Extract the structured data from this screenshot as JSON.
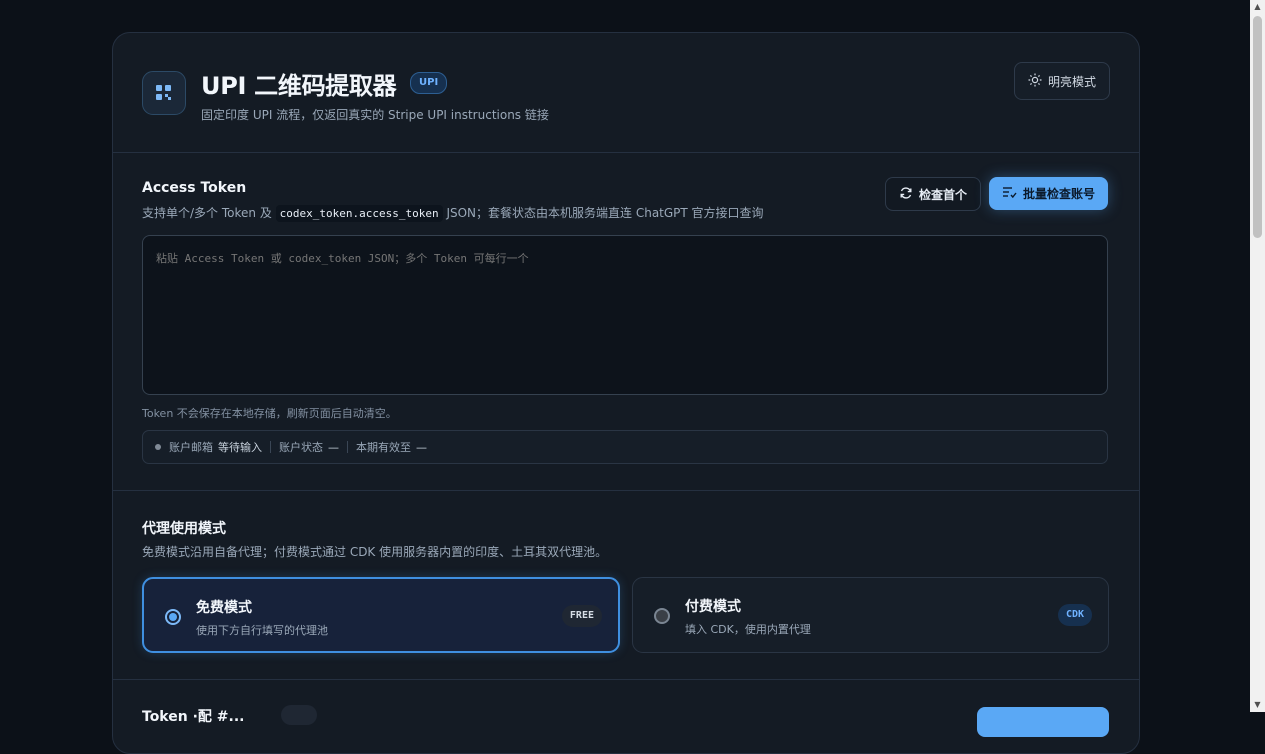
{
  "header": {
    "title": "UPI 二维码提取器",
    "badge": "UPI",
    "subtitle": "固定印度 UPI 流程，仅返回真实的 Stripe UPI instructions 链接",
    "theme_button": "明亮模式"
  },
  "token_section": {
    "title": "Access Token",
    "desc_prefix": "支持单个/多个 Token 及",
    "desc_code": "codex_token.access_token",
    "desc_suffix": "JSON；套餐状态由本机服务端直连 ChatGPT 官方接口查询",
    "check_first_button": "检查首个",
    "batch_check_button": "批量检查账号",
    "textarea_placeholder": "粘贴 Access Token 或 codex_token JSON；多个 Token 可每行一个",
    "note": "Token 不会保存在本地存储，刷新页面后自动清空。",
    "status": {
      "email_label": "账户邮箱",
      "email_value": "等待输入",
      "account_label": "账户状态",
      "account_value": "—",
      "expiry_label": "本期有效至",
      "expiry_value": "—"
    }
  },
  "proxy_section": {
    "title": "代理使用模式",
    "desc": "免费模式沿用自备代理；付费模式通过 CDK 使用服务器内置的印度、土耳其双代理池。",
    "modes": [
      {
        "title": "免费模式",
        "desc": "使用下方自行填写的代理池",
        "tag": "FREE",
        "selected": true
      },
      {
        "title": "付费模式",
        "desc": "填入 CDK，使用内置代理",
        "tag": "CDK",
        "selected": false
      }
    ]
  },
  "next_section": {
    "title": "Token                     ·配 #..."
  },
  "colors": {
    "accent": "#5aa8f5",
    "background": "#0c1118",
    "card": "#141b24"
  }
}
